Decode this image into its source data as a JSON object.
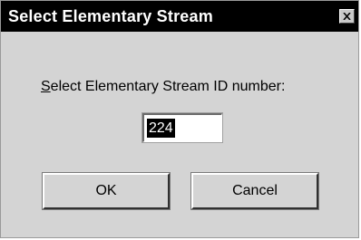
{
  "window": {
    "title": "Select Elementary Stream",
    "close_symbol": "×"
  },
  "prompt": {
    "mnemonic": "S",
    "rest": "elect Elementary Stream ID number:"
  },
  "stream_id_input": {
    "value": "224"
  },
  "buttons": {
    "ok_label": "OK",
    "cancel_label": "Cancel"
  },
  "colors": {
    "titlebar_bg": "#000000",
    "titlebar_text": "#ffffff",
    "dialog_bg": "#d4d4d4",
    "selection_bg": "#000000",
    "selection_text": "#ffffff"
  }
}
